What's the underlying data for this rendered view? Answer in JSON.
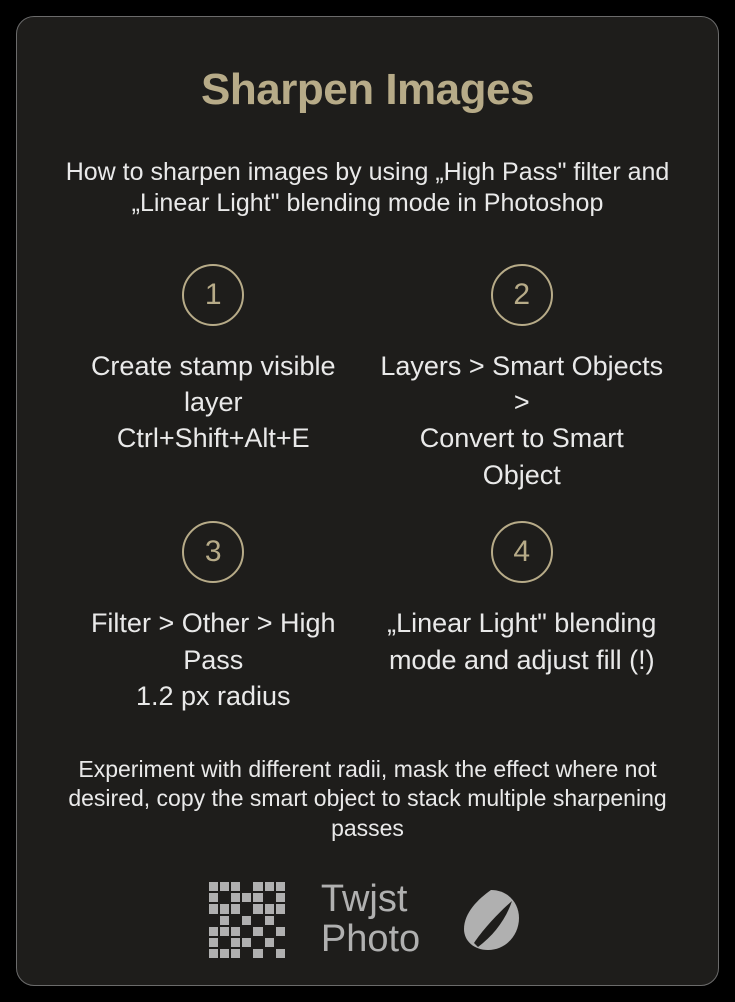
{
  "title": "Sharpen Images",
  "subtitle": "How to sharpen images by using „High Pass\" filter and „Linear Light\" blending mode in Photoshop",
  "steps": [
    {
      "num": "1",
      "text": "Create stamp visible layer\nCtrl+Shift+Alt+E"
    },
    {
      "num": "2",
      "text": "Layers > Smart Objects >\nConvert to Smart Object"
    },
    {
      "num": "3",
      "text": "Filter > Other > High Pass\n1.2 px radius"
    },
    {
      "num": "4",
      "text": "„Linear Light\" blending mode and adjust fill (!)"
    }
  ],
  "footnote": "Experiment with different radii, mask the effect where not desired, copy the smart object to stack multiple sharpening passes",
  "brand": {
    "line1": "Twjst",
    "line2": "Photo"
  }
}
